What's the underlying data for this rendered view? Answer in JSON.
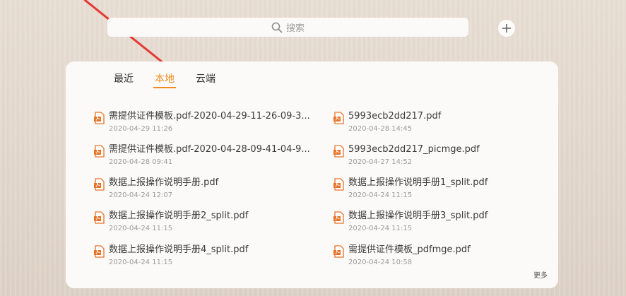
{
  "search": {
    "placeholder": "搜索"
  },
  "tabs": [
    {
      "label": "最近",
      "active": false
    },
    {
      "label": "本地",
      "active": true
    },
    {
      "label": "云端",
      "active": false
    }
  ],
  "files": [
    {
      "name": "需提供证件模板.pdf-2020-04-29-11-26-09-3...",
      "date": "2020-04-29 11:26"
    },
    {
      "name": "5993ecb2dd217.pdf",
      "date": "2020-04-28 14:45"
    },
    {
      "name": "需提供证件模板.pdf-2020-04-28-09-41-04-9...",
      "date": "2020-04-28 09:41"
    },
    {
      "name": "5993ecb2dd217_picmge.pdf",
      "date": "2020-04-27 14:52"
    },
    {
      "name": "数据上报操作说明手册.pdf",
      "date": "2020-04-24 12:07"
    },
    {
      "name": "数据上报操作说明手册1_split.pdf",
      "date": "2020-04-24 11:15"
    },
    {
      "name": "数据上报操作说明手册2_split.pdf",
      "date": "2020-04-24 11:15"
    },
    {
      "name": "数据上报操作说明手册3_split.pdf",
      "date": "2020-04-24 11:15"
    },
    {
      "name": "数据上报操作说明手册4_split.pdf",
      "date": "2020-04-24 11:15"
    },
    {
      "name": "需提供证件模板_pdfmge.pdf",
      "date": "2020-04-24 10:58"
    }
  ],
  "more_label": "更多",
  "colors": {
    "accent": "#f28a1e",
    "pdf_icon": "#e8742a",
    "annotation_arrow": "#e53935"
  }
}
